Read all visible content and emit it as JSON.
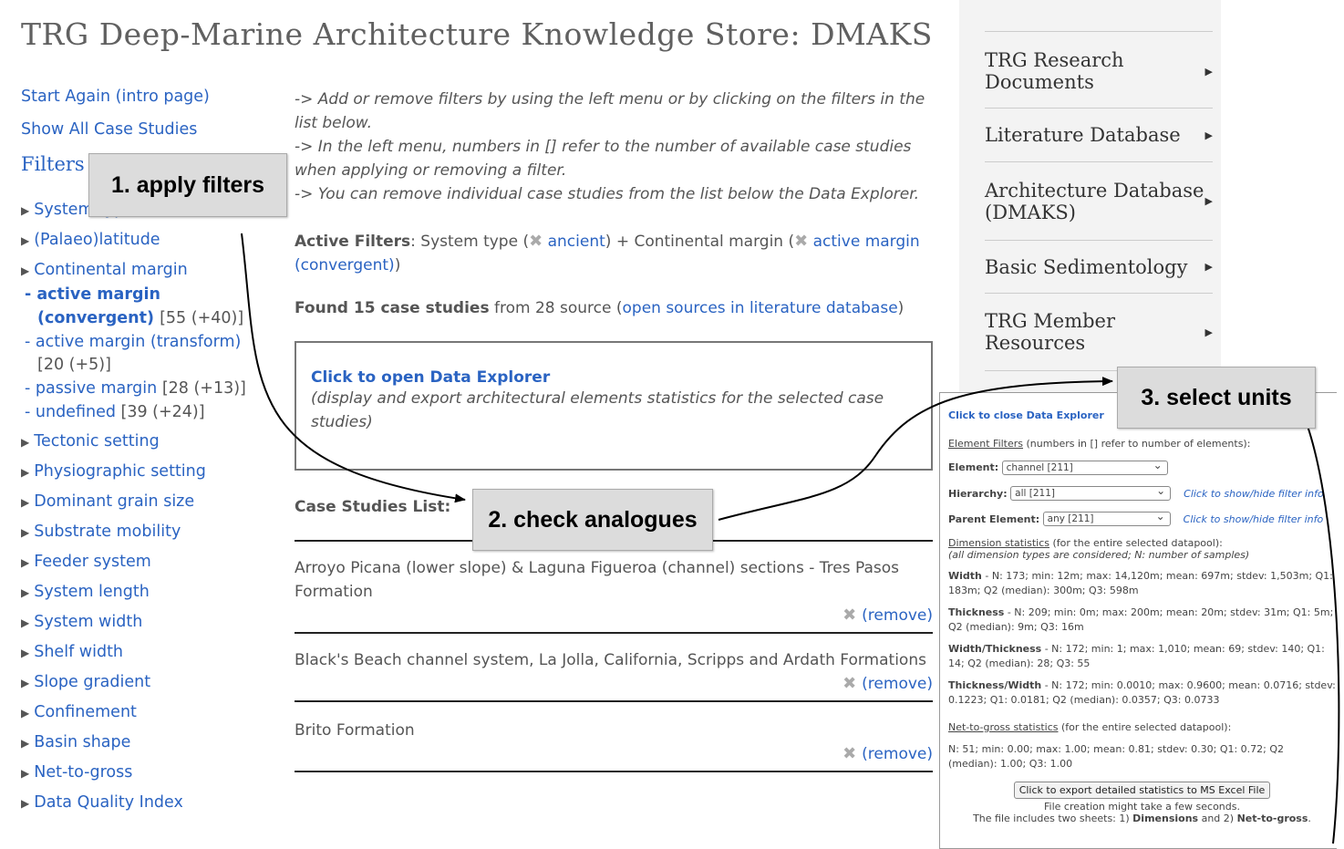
{
  "title": "TRG Deep-Marine Architecture Knowledge Store: DMAKS",
  "nav": {
    "start_again": "Start Again (intro page)",
    "show_all": "Show All Case Studies",
    "filters_heading": "Filters",
    "filters": {
      "system_type": "System type",
      "palaeolatitude": "(Palaeo)latitude",
      "continental_margin": "Continental margin",
      "tectonic_setting": "Tectonic setting",
      "physiographic_setting": "Physiographic setting",
      "dominant_grain_size": "Dominant grain size",
      "substrate_mobility": "Substrate mobility",
      "feeder_system": "Feeder system",
      "system_length": "System length",
      "system_width": "System width",
      "shelf_width": "Shelf width",
      "slope_gradient": "Slope gradient",
      "confinement": "Confinement",
      "basin_shape": "Basin shape",
      "net_to_gross": "Net-to-gross",
      "data_quality_index": "Data Quality Index"
    },
    "margin_options": {
      "active_convergent_1": "active margin",
      "active_convergent_2": "(convergent)",
      "active_convergent_count": "[55 (+40)]",
      "active_transform": "active margin (transform)",
      "active_transform_count": "[20 (+5)]",
      "passive": "passive margin",
      "passive_count": "[28 (+13)]",
      "undefined": "undefined",
      "undefined_count": "[39 (+24)]"
    }
  },
  "main": {
    "instr1": "-> Add or remove filters by using the left menu or by clicking on the filters in the list below.",
    "instr2": "-> In the left menu, numbers in [] refer to the number of available case studies when applying or removing a filter.",
    "instr3": "-> You can remove individual case studies from the list below the Data Explorer.",
    "active_filters_label": "Active Filters",
    "af_system_type": ": System type (",
    "af_ancient": "ancient",
    "af_plus": ") + Continental margin (",
    "af_active": "active margin (convergent)",
    "af_close": ")",
    "found_bold": "Found 15 case studies",
    "found_rest": " from 28 source (",
    "found_link": "open sources in literature database",
    "found_close": ")",
    "explorer_link": "Click to open Data Explorer",
    "explorer_desc": "(display and export architectural elements statistics for the selected case studies)",
    "case_studies_heading": "Case Studies List:",
    "remove_label": "(remove)",
    "case_studies": [
      "Arroyo Picana (lower slope) & Laguna Figueroa (channel) sections - Tres Pasos Formation",
      "Black's Beach channel system, La Jolla, California, Scripps and Ardath Formations",
      "Brito Formation"
    ]
  },
  "right_menu": {
    "items": [
      "TRG Research Documents",
      "Literature Database",
      "Architecture Database (DMAKS)",
      "Basic Sedimentology",
      "TRG Member Resources"
    ]
  },
  "data_explorer": {
    "close_link": "Click to close Data Explorer",
    "element_filters_u": "Element Filters",
    "element_filters_rest": " (numbers in [] refer to number of elements):",
    "element_label": "Element:",
    "element_value": "channel [211]",
    "hierarchy_label": "Hierarchy:",
    "hierarchy_value": "all [211]",
    "parent_label": "Parent Element:",
    "parent_value": "any [211]",
    "filter_info": "Click to show/hide filter info",
    "dim_u": "Dimension statistics",
    "dim_rest": " (for the entire selected datapool):",
    "dim_note": "(all dimension types are considered; N: number of samples)",
    "width_label": "Width",
    "width_text": " - N: 173; min: 12m; max: 14,120m; mean: 697m; stdev: 1,503m; Q1: 183m; Q2 (median): 300m; Q3: 598m",
    "thickness_label": "Thickness",
    "thickness_text": " - N: 209; min: 0m; max: 200m; mean: 20m; stdev: 31m; Q1: 5m; Q2 (median): 9m; Q3: 16m",
    "wt_label": "Width/Thickness",
    "wt_text": " - N: 172; min: 1; max: 1,010; mean: 69; stdev: 140; Q1: 14; Q2 (median): 28; Q3: 55",
    "tw_label": "Thickness/Width",
    "tw_text": " - N: 172; min: 0.0010; max: 0.9600; mean: 0.0716; stdev: 0.1223; Q1: 0.0181; Q2 (median): 0.0357; Q3: 0.0733",
    "ntg_u": "Net-to-gross statistics",
    "ntg_rest": " (for the entire selected datapool):",
    "ntg_text": "N: 51; min: 0.00; max: 1.00; mean: 0.81; stdev: 0.30; Q1: 0.72; Q2 (median): 1.00; Q3: 1.00",
    "export_button": "Click to export detailed statistics to MS Excel File",
    "export_note": "File creation might take a few seconds.",
    "sheets_pre": "The file includes two sheets: 1) ",
    "sheets_dim": "Dimensions",
    "sheets_and": " and 2) ",
    "sheets_ntg": "Net-to-gross",
    "sheets_end": "."
  },
  "callouts": {
    "c1": "1. apply filters",
    "c2": "2. check analogues",
    "c3": "3. select units"
  }
}
